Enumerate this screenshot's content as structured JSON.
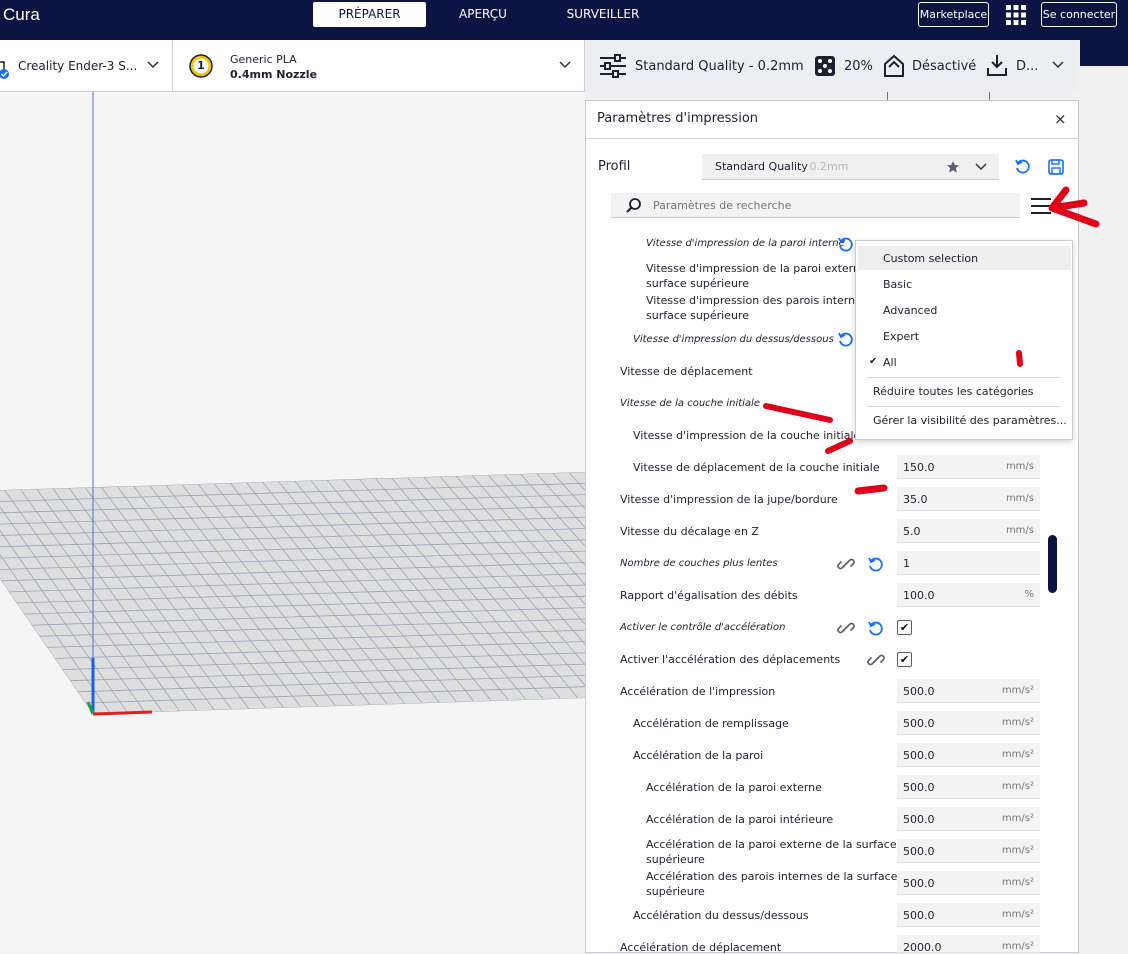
{
  "app": {
    "title": "Cura"
  },
  "stages": [
    {
      "label": "PRÉPARER",
      "active": true
    },
    {
      "label": "APERÇU",
      "active": false
    },
    {
      "label": "SURVEILLER",
      "active": false
    }
  ],
  "top_right": {
    "marketplace": "Marketplace",
    "signin": "Se connecter"
  },
  "machine": {
    "printer": "Creality Ender-3 S...",
    "extruder_number": "1",
    "material": "Generic PLA",
    "nozzle": "0.4mm Nozzle",
    "quality": "Standard Quality - 0.2mm",
    "infill": "20%",
    "support": "Désactivé",
    "adhesion": "D..."
  },
  "panel": {
    "title": "Paramètres d'impression",
    "profile_label": "Profil",
    "profile_name": "Standard Quality",
    "profile_suffix": " - 0.2mm",
    "search_placeholder": "Paramètres de recherche"
  },
  "settings": [
    {
      "label": "Vitesse d'impression de la paroi interne",
      "italic": true
    },
    {
      "label": "Vitesse d'impression de la paroi externe",
      "label2": "surface supérieure"
    },
    {
      "label": "Vitesse d'impression des parois internes",
      "label2": "surface supérieure"
    },
    {
      "label": "Vitesse d'impression du dessus/dessous",
      "italic": true
    },
    {
      "label": "Vitesse de déplacement"
    },
    {
      "label": "Vitesse de la couche initiale",
      "italic": true
    },
    {
      "label": "Vitesse d'impression de la couche initiale"
    },
    {
      "label": "Vitesse de déplacement de la couche initiale",
      "value": "150.0",
      "unit": "mm/s"
    },
    {
      "label": "Vitesse d'impression de la jupe/bordure",
      "value": "35.0",
      "unit": "mm/s"
    },
    {
      "label": "Vitesse du décalage en Z",
      "value": "5.0",
      "unit": "mm/s"
    },
    {
      "label": "Nombre de couches plus lentes",
      "value": "1",
      "italic": true
    },
    {
      "label": "Rapport d'égalisation des débits",
      "value": "100.0",
      "unit": "%"
    },
    {
      "label": "Activer le contrôle d'accélération",
      "italic": true,
      "checked": true
    },
    {
      "label": "Activer l'accélération des déplacements",
      "checked": true
    },
    {
      "label": "Accélération de l'impression",
      "value": "500.0",
      "unit": "mm/s²"
    },
    {
      "label": "Accélération de remplissage",
      "value": "500.0",
      "unit": "mm/s²"
    },
    {
      "label": "Accélération de la paroi",
      "value": "500.0",
      "unit": "mm/s²"
    },
    {
      "label": "Accélération de la paroi externe",
      "value": "500.0",
      "unit": "mm/s²"
    },
    {
      "label": "Accélération de la paroi intérieure",
      "value": "500.0",
      "unit": "mm/s²"
    },
    {
      "label": "Accélération de la paroi externe de la surface",
      "label2": "supérieure",
      "value": "500.0",
      "unit": "mm/s²"
    },
    {
      "label": "Accélération des parois internes de la surface",
      "label2": "supérieure",
      "value": "500.0",
      "unit": "mm/s²"
    },
    {
      "label": "Accélération du dessus/dessous",
      "value": "500.0",
      "unit": "mm/s²"
    },
    {
      "label": "Accélération de déplacement",
      "value": "2000.0",
      "unit": "mm/s²"
    }
  ],
  "menu": {
    "items": [
      "Custom selection",
      "Basic",
      "Advanced",
      "Expert",
      "All"
    ],
    "checked_item": "All",
    "collapse": "Réduire toutes les catégories",
    "manage": "Gérer la visibilité des paramètres..."
  },
  "colors": {
    "brand": "#0c1444",
    "accent": "#196ef0",
    "annotation": "#e0001a"
  }
}
